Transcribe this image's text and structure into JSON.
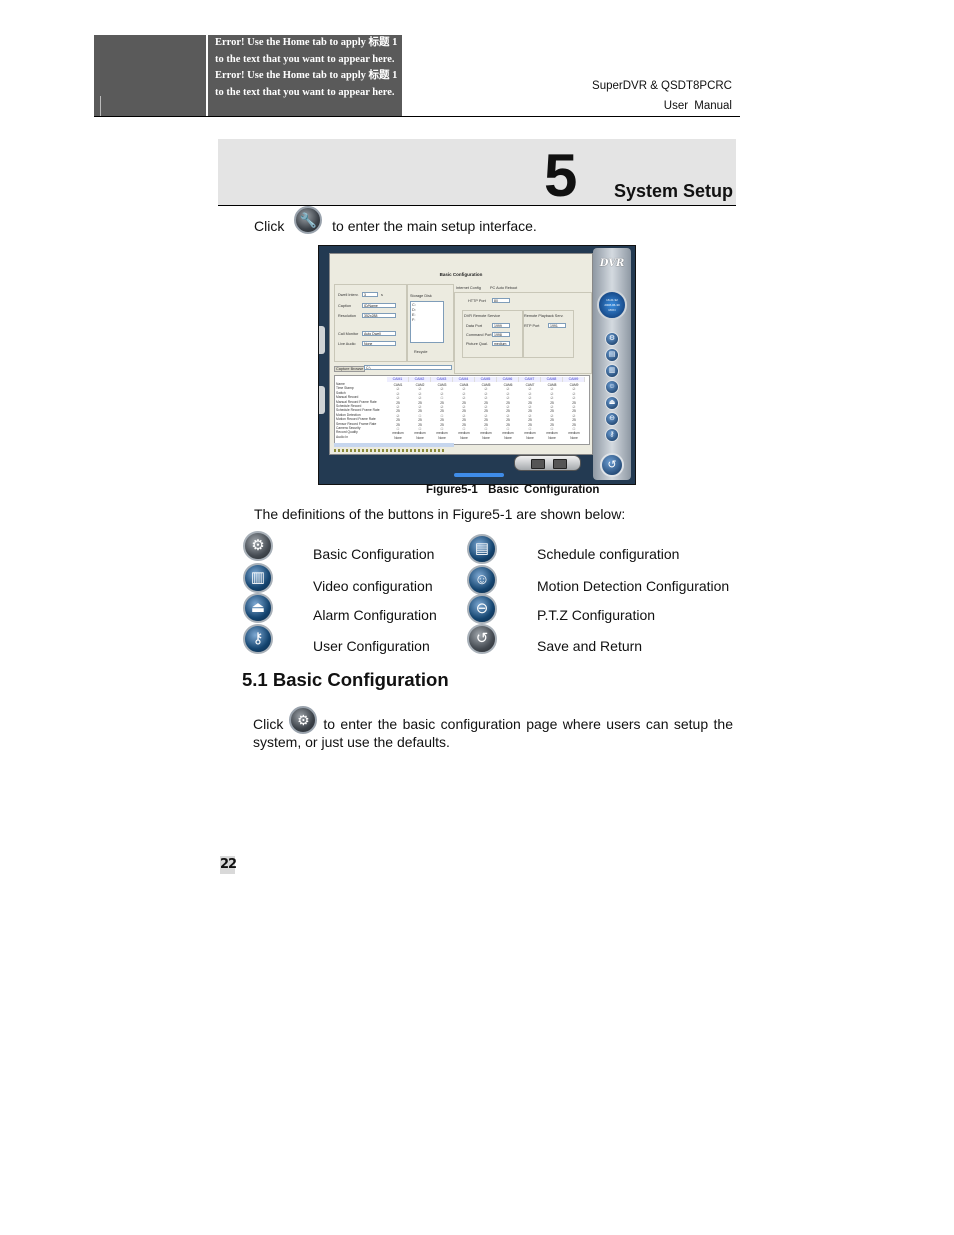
{
  "header": {
    "error_text": "Error! Use the Home tab to apply 标题 1 to the text that you want to appear here. Error! Use the Home tab to apply 标题 1 to the text that you want to appear here.",
    "product": "SuperDVR & QSDT8PCRC",
    "doc_type": "User Manual"
  },
  "chapter": {
    "number": "5",
    "title": "System Setup"
  },
  "intro": {
    "click_word": "Click",
    "icon": "wrench-setup-icon",
    "text": "to enter the main setup interface."
  },
  "figure": {
    "panel_title": "Basic Configuration",
    "fields": {
      "dwell_interval_label": "Dwell Interv.",
      "dwell_interval_value": "3",
      "dwell_unit": "s",
      "caption_label": "Caption",
      "caption_value": "ID/Name",
      "resolution_label": "Resolution",
      "resolution_value": "352x288",
      "call_monitor_label": "Call Monitor",
      "call_monitor_value": "Auto Dwell",
      "live_audio_label": "Live Audio",
      "live_audio_value": "None",
      "storage_disk_label": "Storage Disk",
      "disks": [
        "C:",
        "D:",
        "E:",
        "F:"
      ],
      "recycle_label": "Recycle",
      "capture_browse_label": "Capture Browse",
      "capture_path": "C:\\"
    },
    "network": {
      "tabs": [
        "Internet Config",
        "PC Auto Reboot"
      ],
      "http_port_label": "HTTP Port",
      "http_port_value": "80",
      "enable_server_label": "DVR Remote Service",
      "data_port_label": "Data Port",
      "data_port_value": "1999",
      "command_port_label": "Command Port",
      "command_port_value": "1998",
      "picture_label": "Picture Qual.",
      "picture_value": "medium",
      "remote_playback_label": "Remote Playback Serv.",
      "rtp_port_label": "RTP Port",
      "rtp_port_value": "1991"
    },
    "table": {
      "columns": [
        "CAM1",
        "CAM2",
        "CAM3",
        "CAM4",
        "CAM5",
        "CAM6",
        "CAM7",
        "CAM8",
        "CAM9"
      ],
      "rows": [
        {
          "label": "Name",
          "values": [
            "CAM1",
            "CAM2",
            "CAM3",
            "CAM4",
            "CAM5",
            "CAM6",
            "CAM7",
            "CAM8",
            "CAM9"
          ]
        },
        {
          "label": "Time Stamp",
          "values": [
            "☑",
            "☑",
            "☑",
            "☑",
            "☑",
            "☑",
            "☑",
            "☑",
            "☑"
          ]
        },
        {
          "label": "Switch",
          "values": [
            "☑",
            "☑",
            "☑",
            "☑",
            "☑",
            "☑",
            "☑",
            "☑",
            "☑"
          ]
        },
        {
          "label": "Manual Record",
          "values": [
            "☑",
            "☑",
            "☐",
            "☑",
            "☑",
            "☑",
            "☑",
            "☑",
            "☑"
          ]
        },
        {
          "label": "Manual Record Frame Rate",
          "values": [
            "25",
            "25",
            "25",
            "25",
            "25",
            "25",
            "25",
            "25",
            "25"
          ]
        },
        {
          "label": "Schedule Record",
          "values": [
            "☑",
            "☑",
            "☑",
            "☑",
            "☑",
            "☑",
            "☑",
            "☑",
            "☑"
          ]
        },
        {
          "label": "Schedule Record Frame Rate",
          "values": [
            "25",
            "25",
            "25",
            "25",
            "25",
            "25",
            "25",
            "25",
            "25"
          ]
        },
        {
          "label": "Motion Detection",
          "values": [
            "☑",
            "☐",
            "☐",
            "☑",
            "☑",
            "☑",
            "☑",
            "☑",
            "☑"
          ]
        },
        {
          "label": "Motion Record Frame Rate",
          "values": [
            "25",
            "25",
            "25",
            "25",
            "25",
            "25",
            "25",
            "25",
            "25"
          ]
        },
        {
          "label": "Sensor Record Frame Rate",
          "values": [
            "25",
            "25",
            "25",
            "25",
            "25",
            "25",
            "25",
            "25",
            "25"
          ]
        },
        {
          "label": "Camera Security",
          "values": [
            "☐",
            "☐",
            "☐",
            "☐",
            "☐",
            "☐",
            "☐",
            "☐",
            "☐"
          ]
        },
        {
          "label": "Record Quality",
          "values": [
            "medium",
            "medium",
            "medium",
            "medium",
            "medium",
            "medium",
            "medium",
            "medium",
            "medium"
          ]
        },
        {
          "label": "Audio In",
          "values": [
            "None",
            "None",
            "None",
            "None",
            "None",
            "None",
            "None",
            "None",
            "None"
          ]
        }
      ]
    },
    "side_panel": {
      "brand": "DVR",
      "clock_time": "16:21:32",
      "clock_date": "2008-06-30",
      "clock_day": "MON"
    },
    "caption_label": "Figure5-1",
    "caption_title": "Basic Configuration"
  },
  "definitions_intro": "The definitions of the buttons in Figure5-1 are shown below:",
  "definitions": [
    {
      "icon": "gear-icon",
      "label": "Basic Configuration"
    },
    {
      "icon": "calendar-icon",
      "label": "Schedule configuration"
    },
    {
      "icon": "monitor-icon",
      "label": "Video configuration"
    },
    {
      "icon": "running-man-icon",
      "label": "Motion Detection Configuration"
    },
    {
      "icon": "alarm-bell-icon",
      "label": "Alarm Configuration"
    },
    {
      "icon": "ptz-camera-icon",
      "label": "P.T.Z Configuration"
    },
    {
      "icon": "key-icon",
      "label": "User Configuration"
    },
    {
      "icon": "return-arrow-icon",
      "label": "Save and Return"
    }
  ],
  "section": {
    "heading": "5.1 Basic Configuration",
    "click_word": "Click",
    "icon": "gear-icon",
    "text": "to enter the basic configuration page where users can setup the system, or just use the defaults."
  },
  "page_number": "22"
}
